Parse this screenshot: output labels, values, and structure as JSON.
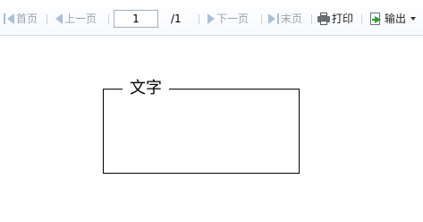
{
  "toolbar": {
    "first_label": "首页",
    "prev_label": "上一页",
    "page_value": "1",
    "page_total": "/1",
    "next_label": "下一页",
    "last_label": "末页",
    "print_label": "打印",
    "export_label": "输出"
  },
  "content": {
    "group_label": "文字"
  },
  "colors": {
    "disabled_text": "#9aa3ad",
    "nav_arrow": "#a9c0d6",
    "export_arrow": "#2f9a3a"
  }
}
